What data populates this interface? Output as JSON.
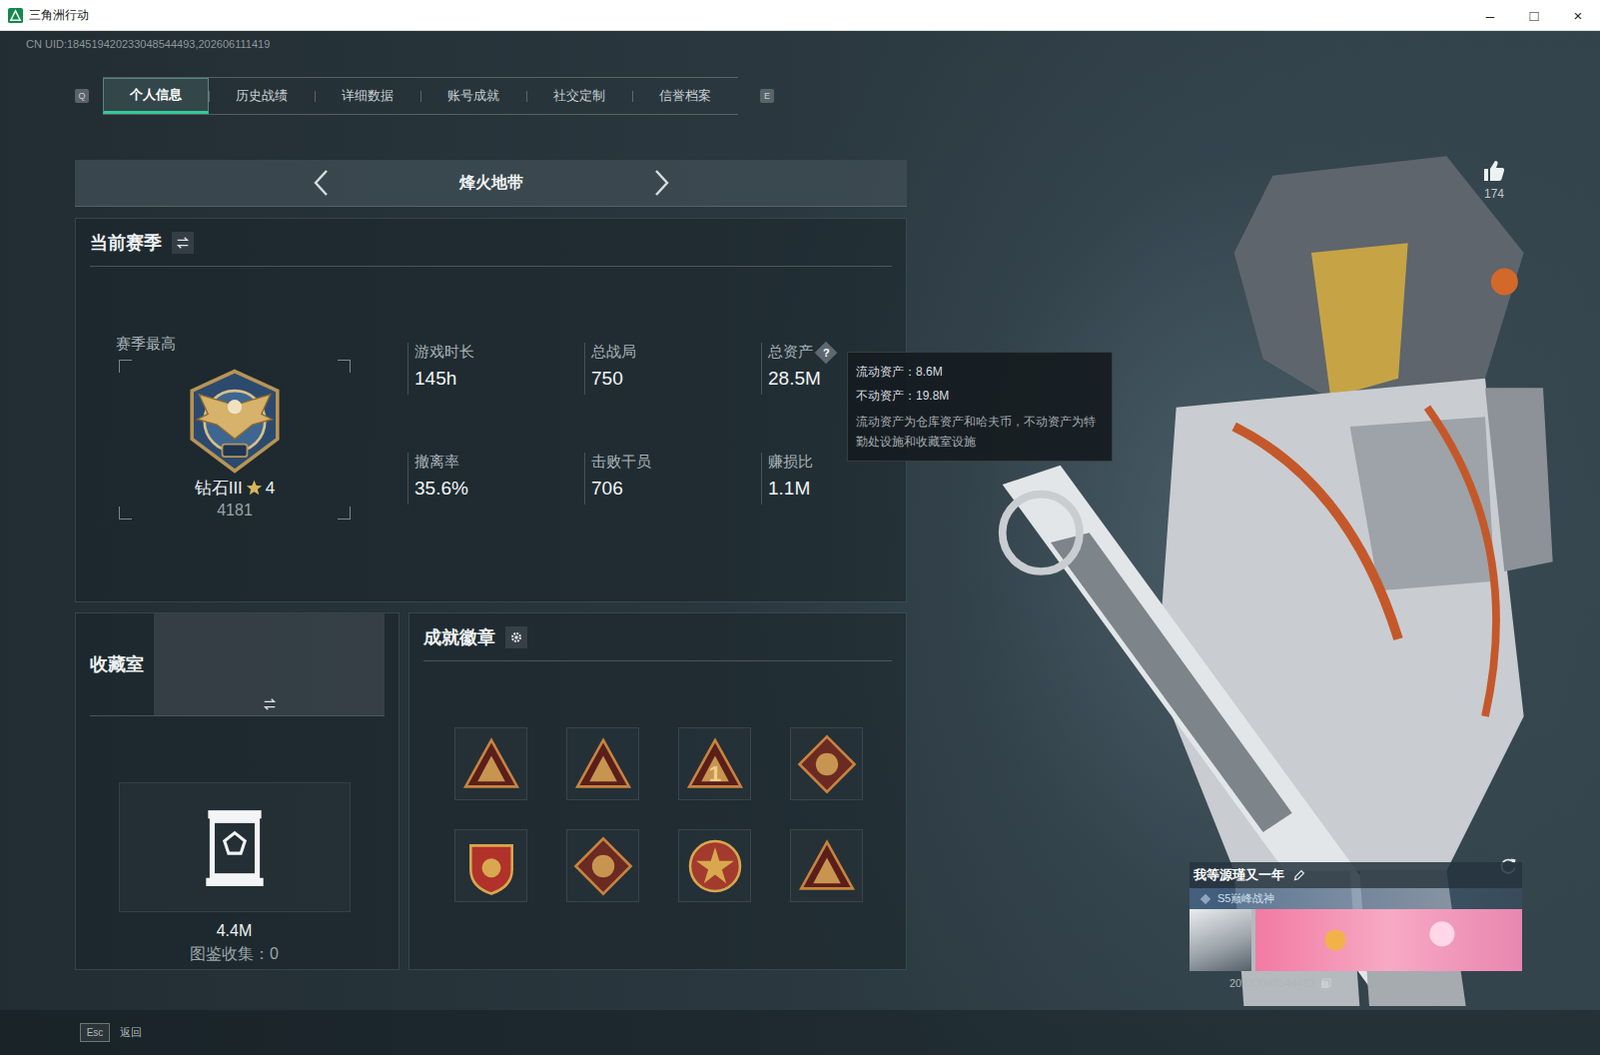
{
  "window": {
    "title": "三角洲行动",
    "controls": [
      "–",
      "□",
      "×"
    ]
  },
  "uid": "CN UID:184519420233048544493,202606111419",
  "tabs": {
    "prev_key": "Q",
    "next_key": "E",
    "items": [
      {
        "label": "个人信息",
        "selected": true
      },
      {
        "label": "历史战绩",
        "selected": false
      },
      {
        "label": "详细数据",
        "selected": false
      },
      {
        "label": "账号成就",
        "selected": false
      },
      {
        "label": "社交定制",
        "selected": false
      },
      {
        "label": "信誉档案",
        "selected": false
      }
    ]
  },
  "mode": {
    "label": "烽火地带"
  },
  "season": {
    "title": "当前赛季",
    "best_label": "赛季最高",
    "rank": "钻石III",
    "stars": "4",
    "score": "4181",
    "stats": [
      {
        "label": "游戏时长",
        "value": "145h",
        "help": ""
      },
      {
        "label": "总战局",
        "value": "750",
        "help": ""
      },
      {
        "label": "总资产",
        "value": "28.5M",
        "help": "?"
      },
      {
        "label": "撤离率",
        "value": "35.6%",
        "help": ""
      },
      {
        "label": "击败干员",
        "value": "706",
        "help": ""
      },
      {
        "label": "赚损比",
        "value": "1.1M",
        "help": ""
      }
    ]
  },
  "tooltip": {
    "lines": [
      "流动资产：8.6M",
      "不动资产：19.8M"
    ],
    "note": "流动资产为仓库资产和哈夫币，不动资产为特勤处设施和收藏室设施"
  },
  "collection": {
    "title": "收藏室",
    "value": "4.4M",
    "catalog": "图鉴收集：0"
  },
  "badges": {
    "title": "成就徽章",
    "items": [
      {
        "kind": "triangle",
        "glyph": ""
      },
      {
        "kind": "triangle",
        "glyph": ""
      },
      {
        "kind": "triangle",
        "glyph": "1"
      },
      {
        "kind": "diamond",
        "glyph": ""
      },
      {
        "kind": "shield",
        "glyph": ""
      },
      {
        "kind": "diamond",
        "glyph": ""
      },
      {
        "kind": "medal",
        "glyph": ""
      },
      {
        "kind": "triangle",
        "glyph": ""
      }
    ]
  },
  "likes": "174",
  "card": {
    "name": "我等源瑾又一年",
    "title": "S5巅峰战神",
    "uid": "20233048544493"
  },
  "footer": {
    "key": "Esc",
    "label": "返回"
  }
}
